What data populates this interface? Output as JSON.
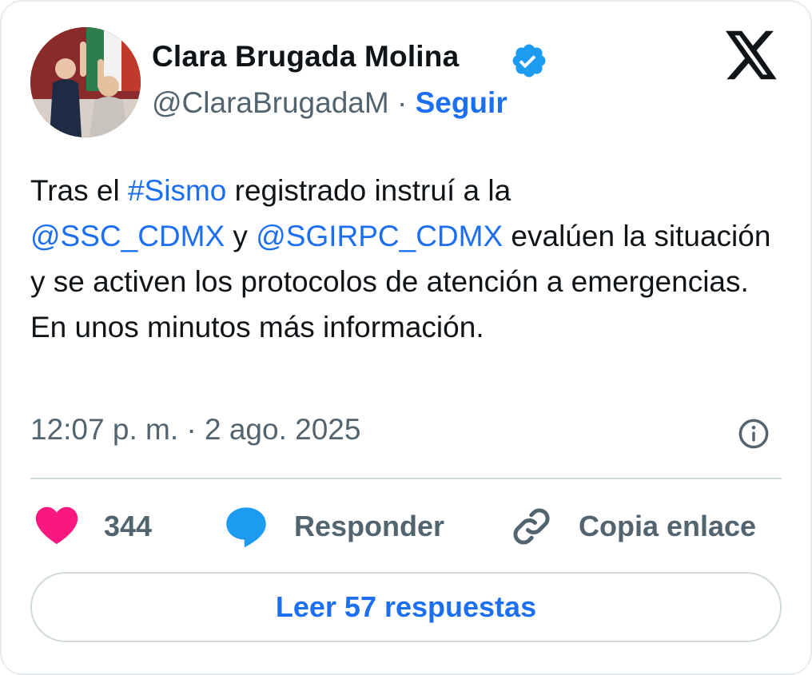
{
  "author": {
    "name": "Clara Brugada Molina",
    "handle": "@ClaraBrugadaM",
    "separator": "·",
    "follow_label": "Seguir",
    "verified": true
  },
  "tweet": {
    "segments": [
      {
        "text": "Tras el ",
        "type": "text"
      },
      {
        "text": "#Sismo",
        "type": "link"
      },
      {
        "text": " registrado instruí a la ",
        "type": "text"
      },
      {
        "text": "@SSC_CDMX",
        "type": "link"
      },
      {
        "text": " y ",
        "type": "text"
      },
      {
        "text": "@SGIRPC_CDMX",
        "type": "link"
      },
      {
        "text": " evalúen la situación y se activen los protocolos de atención a emergencias. En unos minutos más información.",
        "type": "text"
      }
    ],
    "timestamp": "12:07 p. m. · 2 ago. 2025"
  },
  "actions": {
    "like_count": "344",
    "reply_label": "Responder",
    "copy_link_label": "Copia enlace"
  },
  "read_replies_label": "Leer 57 respuestas",
  "colors": {
    "link": "#1d6ff2",
    "heart": "#f91880",
    "reply_bubble": "#1d9bf0",
    "verified": "#1d9bf0",
    "muted": "#536471"
  },
  "icons": [
    "verified-badge-icon",
    "x-logo-icon",
    "info-icon",
    "heart-icon",
    "reply-bubble-icon",
    "link-icon"
  ]
}
